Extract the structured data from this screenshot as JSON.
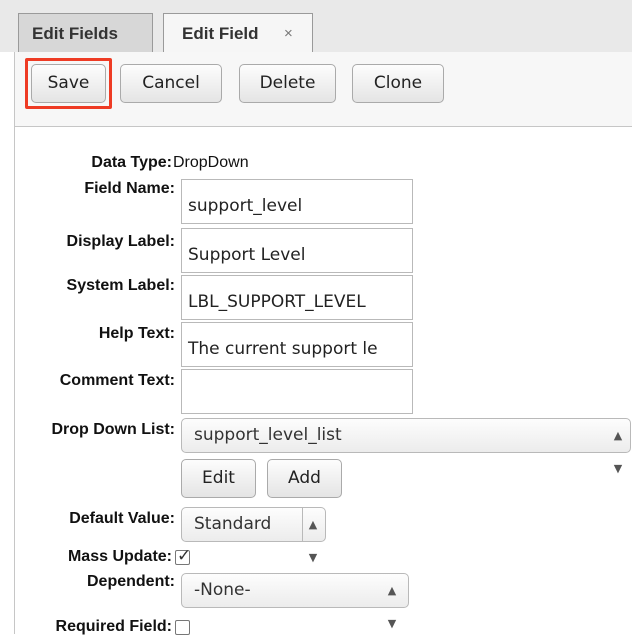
{
  "tabs": [
    {
      "label": "Edit Fields"
    },
    {
      "label": "Edit Field",
      "close_icon": "×"
    }
  ],
  "toolbar": {
    "save_label": "Save",
    "cancel_label": "Cancel",
    "delete_label": "Delete",
    "clone_label": "Clone",
    "highlight_color": "#ee3b24"
  },
  "form": {
    "data_type": {
      "label": "Data Type:",
      "value": "DropDown"
    },
    "field_name": {
      "label": "Field Name:",
      "value": "support_level"
    },
    "display_label": {
      "label": "Display Label:",
      "value": "Support Level"
    },
    "system_label": {
      "label": "System Label:",
      "value": "LBL_SUPPORT_LEVEL"
    },
    "help_text": {
      "label": "Help Text:",
      "value": "The current support le"
    },
    "comment_text": {
      "label": "Comment Text:",
      "value": ""
    },
    "drop_down_list": {
      "label": "Drop Down List:",
      "value": "support_level_list",
      "edit_label": "Edit",
      "add_label": "Add"
    },
    "default_value": {
      "label": "Default Value:",
      "value": "Standard"
    },
    "mass_update": {
      "label": "Mass Update:",
      "checked": true
    },
    "dependent": {
      "label": "Dependent:",
      "value": "-None-"
    },
    "required_field": {
      "label": "Required Field:",
      "checked": false
    }
  }
}
